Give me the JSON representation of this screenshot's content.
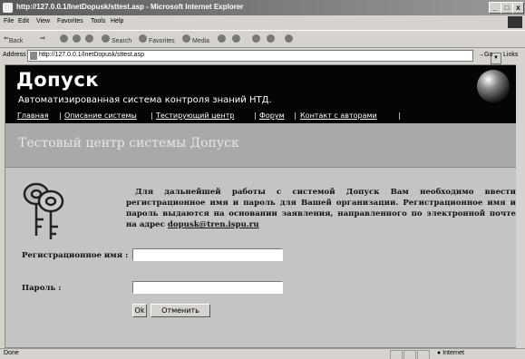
{
  "window": {
    "title": "http://127.0.0.1/InetDopusk/sttest.asp - Microsoft Internet Explorer",
    "minimize": "_",
    "maximize": "□",
    "close": "x"
  },
  "menu": [
    "File",
    "Edit",
    "View",
    "Favorites",
    "Tools",
    "Help"
  ],
  "toolbar": {
    "back": "Back",
    "search": "Search",
    "favorites": "Favorites",
    "media": "Media"
  },
  "address": {
    "label": "Address",
    "url": "http://127.0.0.1/InetDopusk/sttest.asp",
    "go": "Go",
    "links": "Links"
  },
  "page": {
    "title": "Допуск",
    "subtitle": "Автоматизированная система контроля знаний НТД.",
    "nav": [
      "Главная",
      "Описание системы",
      "Тестирующий центр",
      "Форум",
      "Контакт с авторами"
    ],
    "heading": "Тестовый центр системы Допуск",
    "paragraph": "Для дальнейшей работы с системой Допуск Вам необходимо ввести регистрационное имя и пароль для Вашей организации. Регистрационное имя и пароль выдаются на основании заявления, направленного по электронной почте на адрес",
    "email": "dopusk@tren.ispu.ru",
    "login_label": "Регистрационное имя :",
    "password_label": "Пароль :",
    "ok": "Ok",
    "cancel": "Отменить"
  },
  "status": {
    "left": "Done",
    "zone": "Internet"
  }
}
